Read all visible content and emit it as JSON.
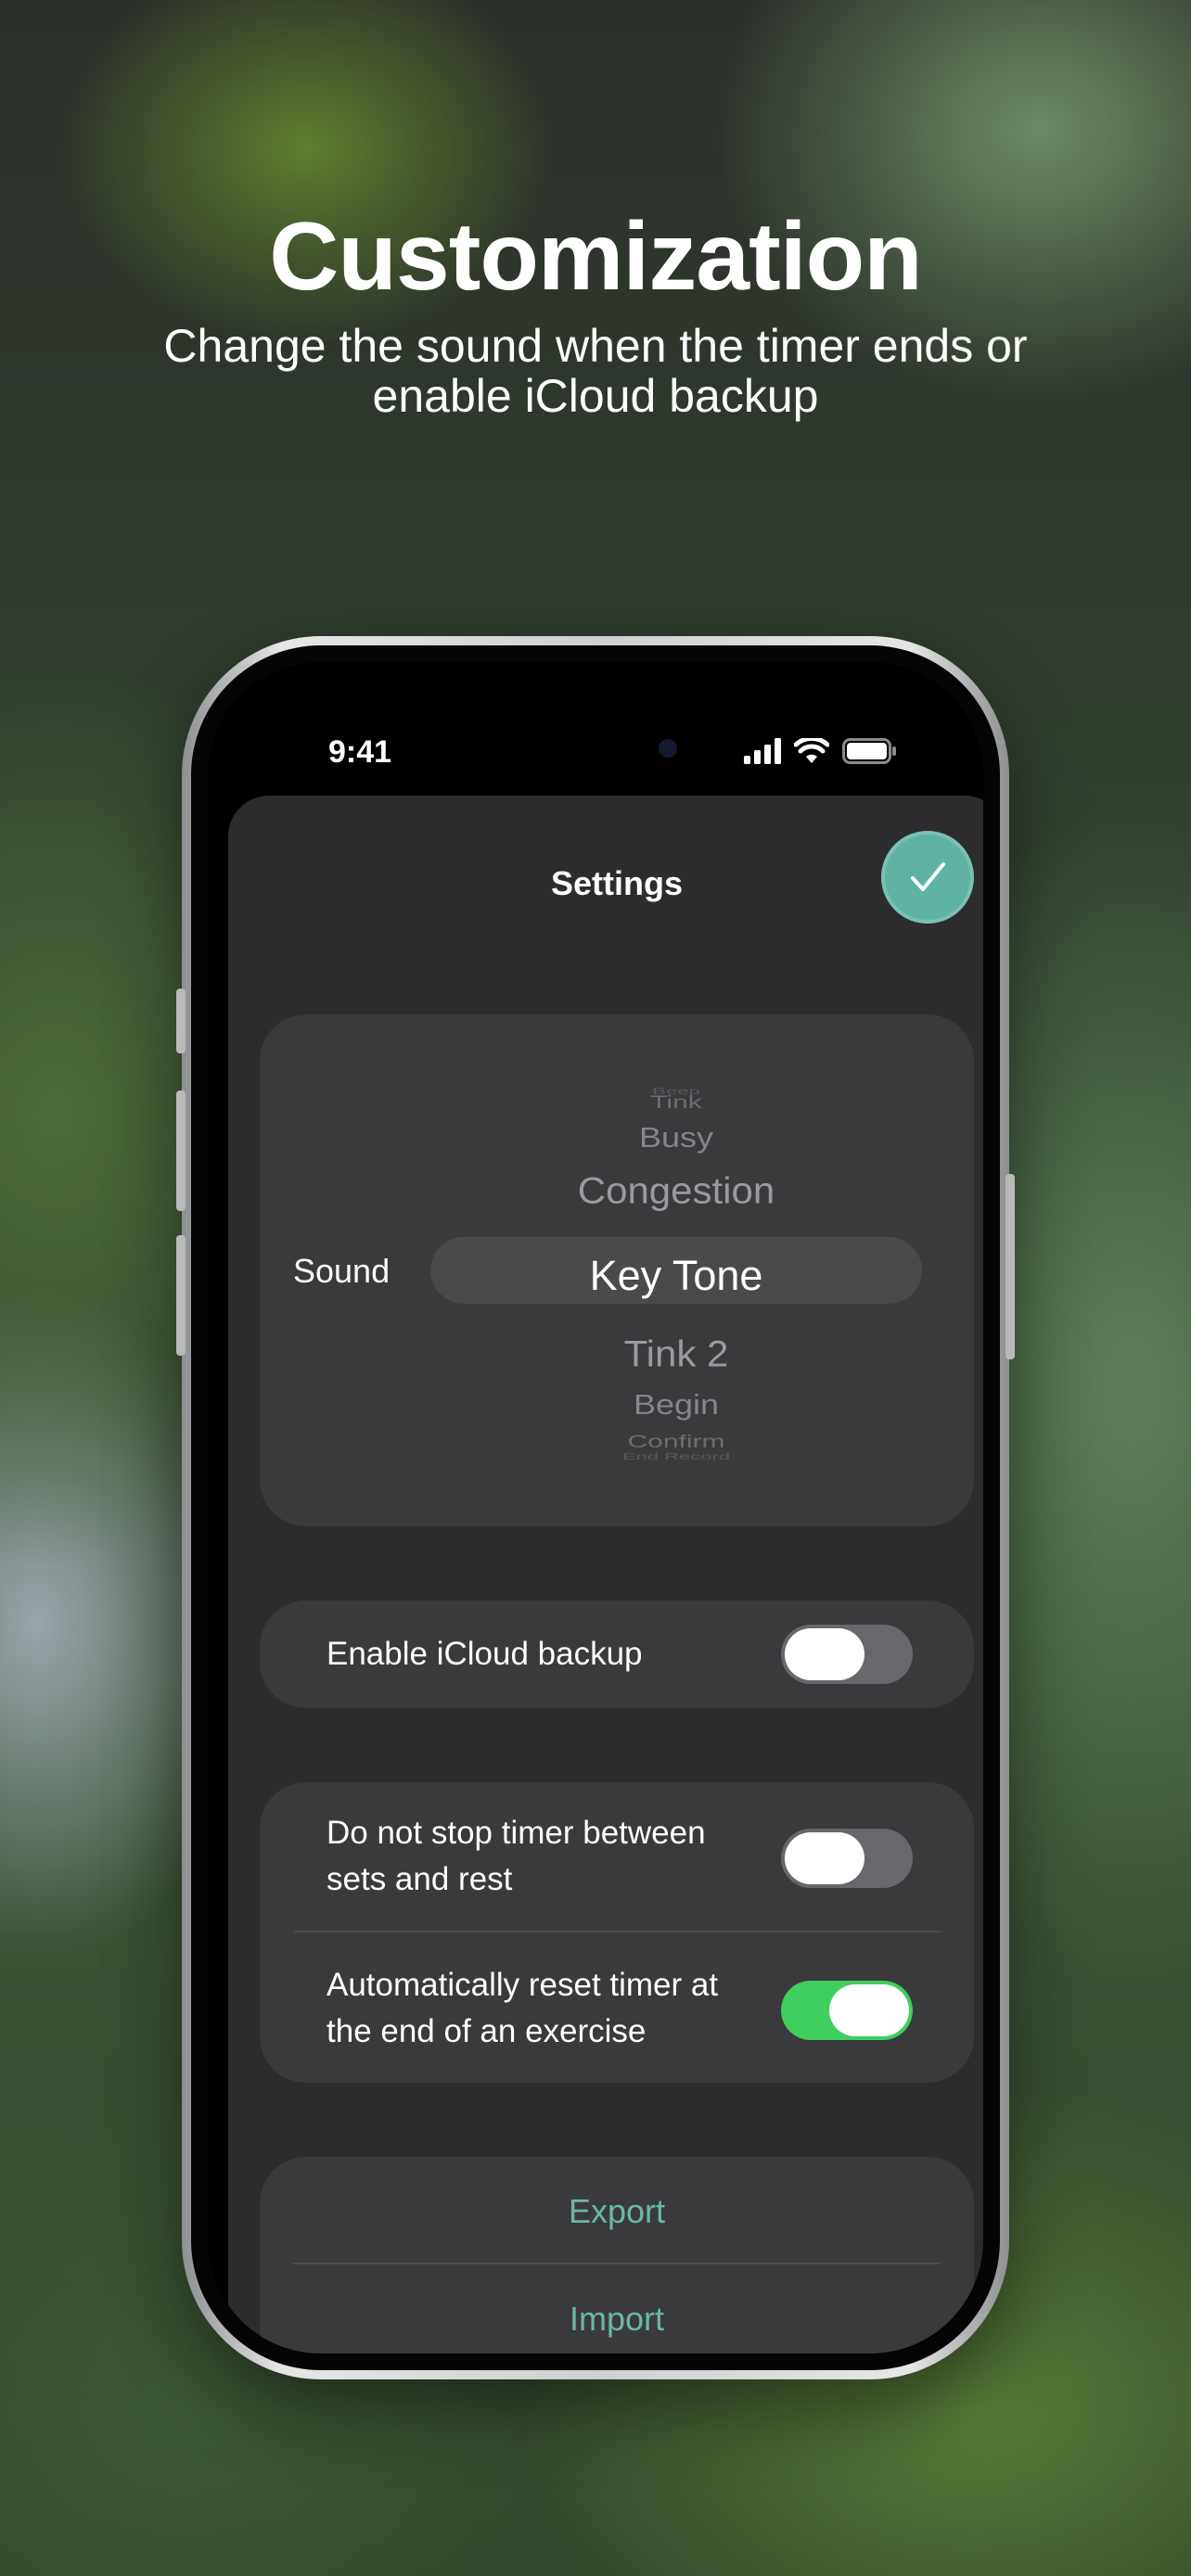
{
  "promo": {
    "title": "Customization",
    "subtitle": "Change the sound when the timer ends or enable iCloud backup"
  },
  "status_bar": {
    "time": "9:41",
    "icons": [
      "signal-icon",
      "wifi-icon",
      "battery-icon"
    ]
  },
  "settings": {
    "title": "Settings",
    "confirm_icon": "checkmark-icon",
    "sound": {
      "label": "Sound",
      "options": [
        "Beep",
        "Tink",
        "Busy",
        "Congestion",
        "Key Tone",
        "Tink 2",
        "Begin",
        "Confirm",
        "End Record"
      ],
      "selected": "Key Tone"
    },
    "icloud": {
      "label": "Enable iCloud backup",
      "enabled": false
    },
    "timer_options": [
      {
        "label_line1": "Do not stop timer between",
        "label_line2": "sets and rest",
        "enabled": false
      },
      {
        "label_line1": "Automatically reset timer at",
        "label_line2": "the end of an exercise",
        "enabled": true
      }
    ],
    "actions": {
      "export_label": "Export",
      "import_label": "Import"
    }
  },
  "colors": {
    "accent": "#5fb3a2",
    "toggle_on": "#3ecf5e",
    "toggle_off": "#68686c",
    "card": "#3a3a3c",
    "sheet": "#2c2c2e"
  }
}
